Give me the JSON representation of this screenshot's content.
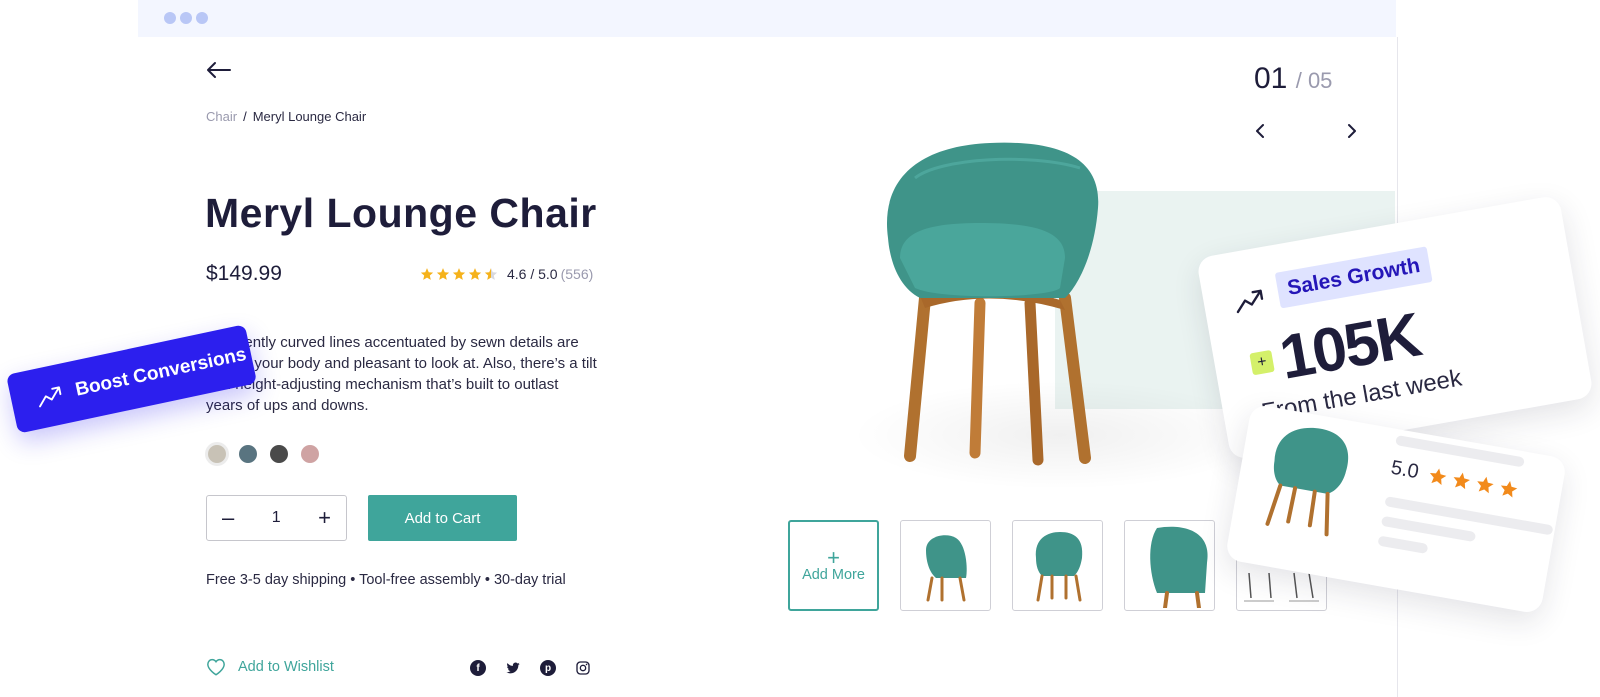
{
  "breadcrumb": {
    "parent": "Chair",
    "separator": "/",
    "current": "Meryl Lounge Chair"
  },
  "product": {
    "title": "Meryl Lounge Chair",
    "price": "$149.99",
    "rating": {
      "stars": 4.5,
      "value_text": "4.6 / 5.0",
      "count_text": "(556)"
    },
    "description": "The gently curved lines accentuated by sewn details are kind to your body and pleasant to look at. Also, there’s a tilt and height-adjusting mechanism that’s built to outlast years of ups and downs.",
    "colors": [
      "#c8c2b6",
      "#597480",
      "#4a4a4a",
      "#cfa3a3"
    ],
    "quantity": "1",
    "add_to_cart_label": "Add to Cart",
    "shipping_text": "Free 3-5 day shipping • Tool-free assembly • 30-day trial",
    "wishlist_label": "Add to Wishlist",
    "social_icons": [
      "facebook-icon",
      "twitter-icon",
      "pinterest-icon",
      "instagram-icon"
    ]
  },
  "gallery": {
    "current_index": "01",
    "total_text": "/ 05",
    "add_more_label": "Add More",
    "plus_glyph": "+"
  },
  "sales_card": {
    "tag": "Sales Growth",
    "plus_glyph": "+",
    "value": "105K",
    "subtitle": "From the last week"
  },
  "review_card": {
    "score": "5.0",
    "stars": 4
  },
  "boost_badge": {
    "label": "Boost Conversions"
  },
  "qty_controls": {
    "minus": "–",
    "plus": "+"
  },
  "colors": {
    "accent": "#3fa59b",
    "boost": "#2c1fee",
    "tag_text": "#2516b8",
    "tag_bg": "#dfe3ff",
    "star": "#f5b21b",
    "review_star": "#f28a1b"
  }
}
